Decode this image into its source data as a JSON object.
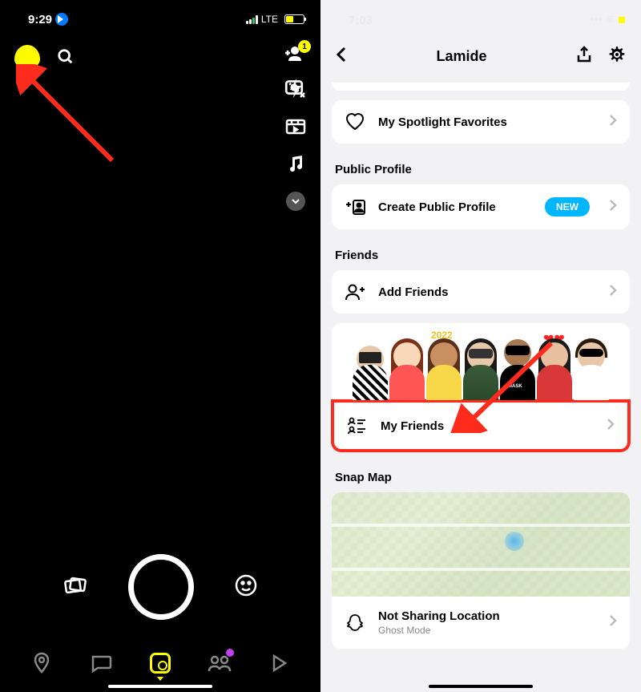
{
  "left": {
    "status": {
      "time": "9:29",
      "network": "LTE"
    },
    "add_friend_badge": "1"
  },
  "right": {
    "title": "Lamide",
    "spotlight": {
      "label": "My Spotlight Favorites"
    },
    "public_profile": {
      "title": "Public Profile",
      "create": "Create Public Profile",
      "badge": "NEW"
    },
    "friends": {
      "title": "Friends",
      "add": "Add Friends",
      "my": "My Friends"
    },
    "snap_map": {
      "title": "Snap Map",
      "location_label": "Not Sharing Location",
      "location_sub": "Ghost Mode"
    }
  }
}
